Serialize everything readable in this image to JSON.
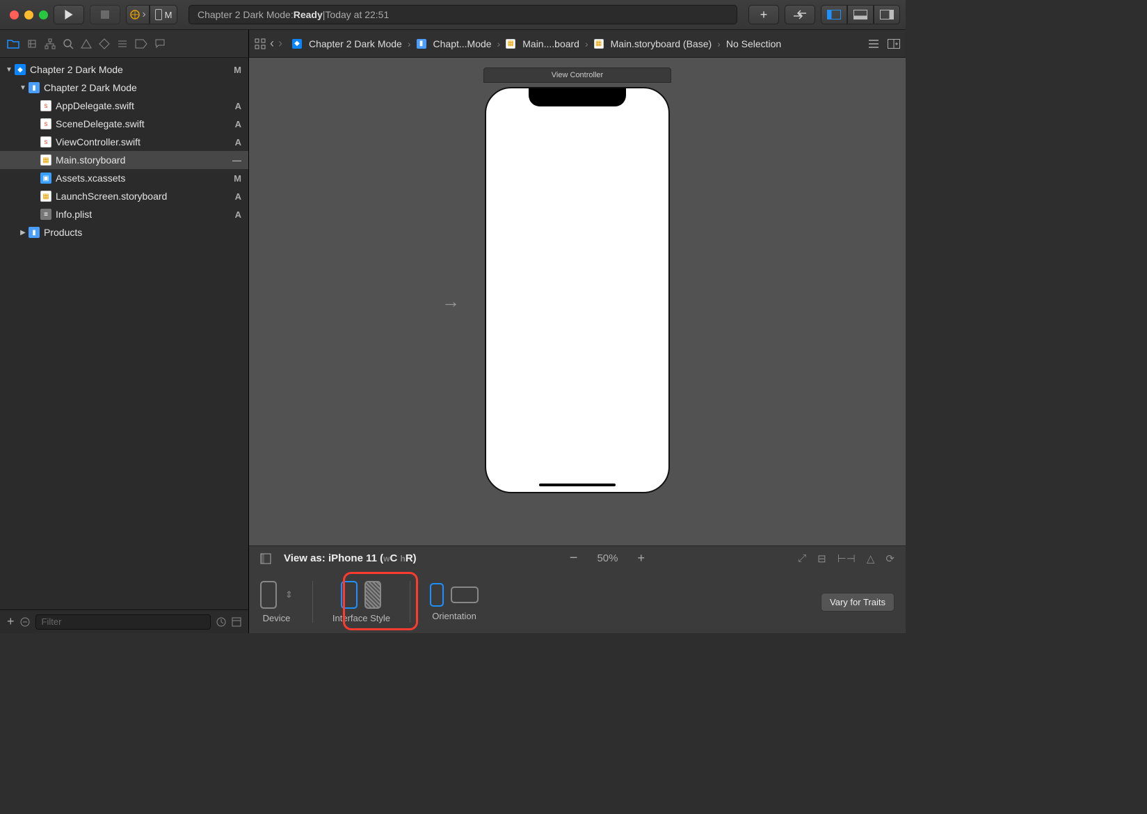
{
  "toolbar": {
    "status_prefix": "Chapter 2 Dark Mode: ",
    "status_state": "Ready",
    "status_sep": " | ",
    "status_time": "Today at 22:51",
    "scheme_label": "M"
  },
  "navigator": {
    "root": {
      "name": "Chapter 2 Dark Mode",
      "badge": "M"
    },
    "group": {
      "name": "Chapter 2 Dark Mode"
    },
    "files": [
      {
        "name": "AppDelegate.swift",
        "badge": "A",
        "kind": "swift"
      },
      {
        "name": "SceneDelegate.swift",
        "badge": "A",
        "kind": "swift"
      },
      {
        "name": "ViewController.swift",
        "badge": "A",
        "kind": "swift"
      },
      {
        "name": "Main.storyboard",
        "badge": "—",
        "kind": "sb",
        "selected": true
      },
      {
        "name": "Assets.xcassets",
        "badge": "M",
        "kind": "assets"
      },
      {
        "name": "LaunchScreen.storyboard",
        "badge": "A",
        "kind": "sb"
      },
      {
        "name": "Info.plist",
        "badge": "A",
        "kind": "plist"
      }
    ],
    "products": "Products",
    "filter_placeholder": "Filter"
  },
  "jumpbar": {
    "items": [
      "Chapter 2 Dark Mode",
      "Chapt...Mode",
      "Main....board",
      "Main.storyboard (Base)",
      "No Selection"
    ]
  },
  "canvas": {
    "scene_title": "View Controller"
  },
  "traitbar": {
    "viewas_prefix": "View as: ",
    "device": "iPhone 11",
    "size_class_open": " (",
    "size_class_w": "w",
    "size_class_c": "C ",
    "size_class_h": "h",
    "size_class_r": "R",
    "size_class_close": ")",
    "zoom": "50%",
    "device_label": "Device",
    "style_label": "Interface Style",
    "orient_label": "Orientation",
    "vary": "Vary for Traits"
  }
}
